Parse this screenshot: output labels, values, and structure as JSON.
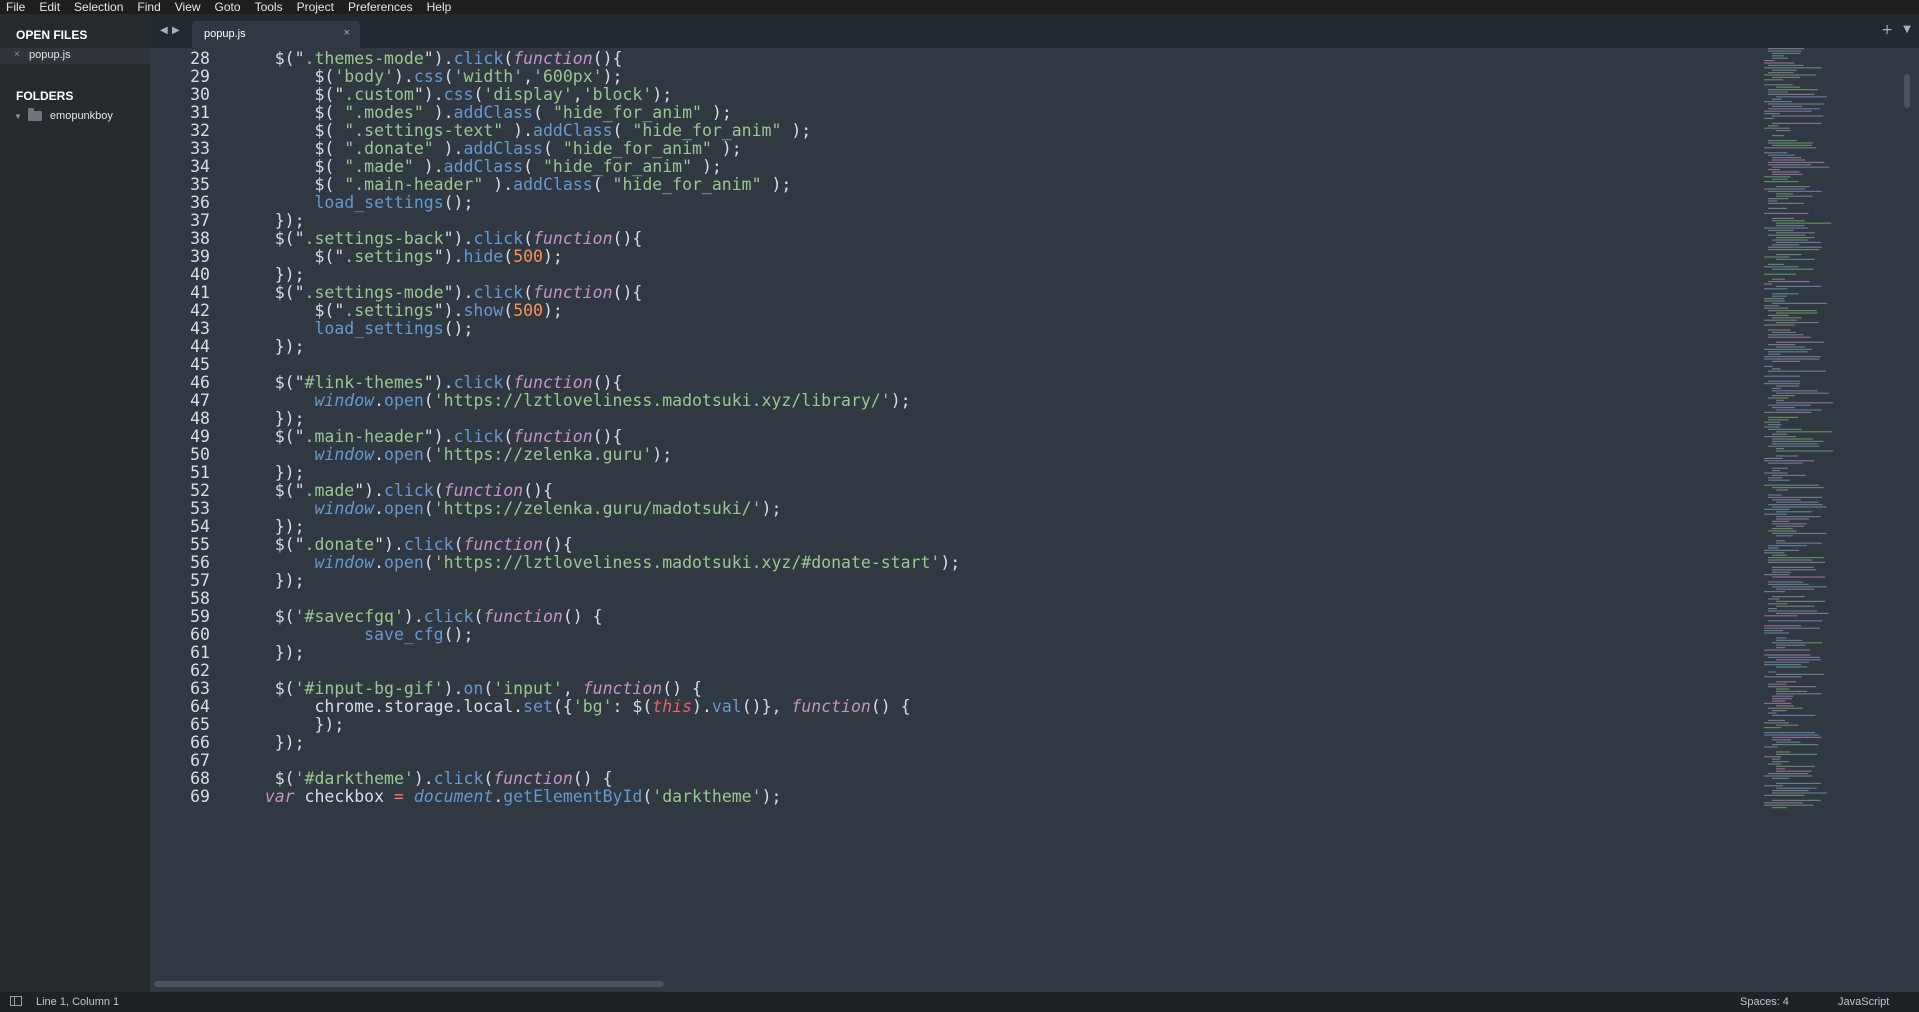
{
  "menu": [
    "File",
    "Edit",
    "Selection",
    "Find",
    "View",
    "Goto",
    "Tools",
    "Project",
    "Preferences",
    "Help"
  ],
  "sidebar": {
    "open_files_heading": "OPEN FILES",
    "open_file": "popup.js",
    "open_file_close": "×",
    "folders_heading": "FOLDERS",
    "folder": "emopunkboy"
  },
  "tabs": {
    "active_label": "popup.js",
    "close_glyph": "×",
    "nav_left": "◀",
    "nav_right": "▶",
    "plus": "+",
    "dropdown": "▼"
  },
  "icons": {
    "panel": "side-panel-icon",
    "folder": "folder-icon",
    "close": "close-icon",
    "chevron": "chevron-down-icon"
  },
  "colors": {
    "background": "#303841",
    "string": "#99c794",
    "method": "#6699cc",
    "keyword": "#c594c5",
    "number": "#f99157",
    "this": "#ec5f67"
  },
  "editor": {
    "first_line": 28,
    "lines": [
      [
        [
          "",
          "    $(\""
        ],
        [
          "s",
          ".themes-mode"
        ],
        [
          "",
          "\")."
        ],
        [
          "m",
          "click"
        ],
        [
          "",
          "("
        ],
        [
          "k",
          "function"
        ],
        [
          "",
          "(){"
        ]
      ],
      [
        [
          "",
          "        $("
        ],
        [
          "s",
          "'body'"
        ],
        [
          "",
          ")."
        ],
        [
          "m",
          "css"
        ],
        [
          "",
          "("
        ],
        [
          "s",
          "'width'"
        ],
        [
          "",
          ","
        ],
        [
          "s",
          "'600px'"
        ],
        [
          "",
          ");"
        ]
      ],
      [
        [
          "",
          "        $(\""
        ],
        [
          "s",
          ".custom"
        ],
        [
          "",
          "\")."
        ],
        [
          "m",
          "css"
        ],
        [
          "",
          "("
        ],
        [
          "s",
          "'display'"
        ],
        [
          "",
          ","
        ],
        [
          "s",
          "'block'"
        ],
        [
          "",
          ");"
        ]
      ],
      [
        [
          "",
          "        $( "
        ],
        [
          "s",
          "\".modes\""
        ],
        [
          "",
          " )."
        ],
        [
          "m",
          "addClass"
        ],
        [
          "",
          "( "
        ],
        [
          "s",
          "\"hide_for_anim\""
        ],
        [
          "",
          " );"
        ]
      ],
      [
        [
          "",
          "        $( "
        ],
        [
          "s",
          "\".settings-text\""
        ],
        [
          "",
          " )."
        ],
        [
          "m",
          "addClass"
        ],
        [
          "",
          "( "
        ],
        [
          "s",
          "\"hide_for_anim\""
        ],
        [
          "",
          " );"
        ]
      ],
      [
        [
          "",
          "        $( "
        ],
        [
          "s",
          "\".donate\""
        ],
        [
          "",
          " )."
        ],
        [
          "m",
          "addClass"
        ],
        [
          "",
          "( "
        ],
        [
          "s",
          "\"hide_for_anim\""
        ],
        [
          "",
          " );"
        ]
      ],
      [
        [
          "",
          "        $( "
        ],
        [
          "s",
          "\".made\""
        ],
        [
          "",
          " )."
        ],
        [
          "m",
          "addClass"
        ],
        [
          "",
          "( "
        ],
        [
          "s",
          "\"hide_for_anim\""
        ],
        [
          "",
          " );"
        ]
      ],
      [
        [
          "",
          "        $( "
        ],
        [
          "s",
          "\".main-header\""
        ],
        [
          "",
          " )."
        ],
        [
          "m",
          "addClass"
        ],
        [
          "",
          "( "
        ],
        [
          "s",
          "\"hide_for_anim\""
        ],
        [
          "",
          " );"
        ]
      ],
      [
        [
          "",
          "        "
        ],
        [
          "m",
          "load_settings"
        ],
        [
          "",
          "();"
        ]
      ],
      [
        [
          "",
          "    });"
        ]
      ],
      [
        [
          "",
          "    $(\""
        ],
        [
          "s",
          ".settings-back"
        ],
        [
          "",
          "\")."
        ],
        [
          "m",
          "click"
        ],
        [
          "",
          "("
        ],
        [
          "k",
          "function"
        ],
        [
          "",
          "(){"
        ]
      ],
      [
        [
          "",
          "        $(\""
        ],
        [
          "s",
          ".settings"
        ],
        [
          "",
          "\")."
        ],
        [
          "m",
          "hide"
        ],
        [
          "",
          "("
        ],
        [
          "n",
          "500"
        ],
        [
          "",
          ");"
        ]
      ],
      [
        [
          "",
          "    });"
        ]
      ],
      [
        [
          "",
          "    $(\""
        ],
        [
          "s",
          ".settings-mode"
        ],
        [
          "",
          "\")."
        ],
        [
          "m",
          "click"
        ],
        [
          "",
          "("
        ],
        [
          "k",
          "function"
        ],
        [
          "",
          "(){"
        ]
      ],
      [
        [
          "",
          "        $(\""
        ],
        [
          "s",
          ".settings"
        ],
        [
          "",
          "\")."
        ],
        [
          "m",
          "show"
        ],
        [
          "",
          "("
        ],
        [
          "n",
          "500"
        ],
        [
          "",
          ");"
        ]
      ],
      [
        [
          "",
          "        "
        ],
        [
          "m",
          "load_settings"
        ],
        [
          "",
          "();"
        ]
      ],
      [
        [
          "",
          "    });"
        ]
      ],
      [
        [
          "",
          ""
        ]
      ],
      [
        [
          "",
          "    $(\""
        ],
        [
          "s",
          "#link-themes"
        ],
        [
          "",
          "\")."
        ],
        [
          "m",
          "click"
        ],
        [
          "",
          "("
        ],
        [
          "k",
          "function"
        ],
        [
          "",
          "(){"
        ]
      ],
      [
        [
          "",
          "        "
        ],
        [
          "w",
          "window"
        ],
        [
          "",
          "."
        ],
        [
          "m",
          "open"
        ],
        [
          "",
          "("
        ],
        [
          "s",
          "'https://lztloveliness.madotsuki.xyz/library/'"
        ],
        [
          "",
          ");"
        ]
      ],
      [
        [
          "",
          "    });"
        ]
      ],
      [
        [
          "",
          "    $(\""
        ],
        [
          "s",
          ".main-header"
        ],
        [
          "",
          "\")."
        ],
        [
          "m",
          "click"
        ],
        [
          "",
          "("
        ],
        [
          "k",
          "function"
        ],
        [
          "",
          "(){"
        ]
      ],
      [
        [
          "",
          "        "
        ],
        [
          "w",
          "window"
        ],
        [
          "",
          "."
        ],
        [
          "m",
          "open"
        ],
        [
          "",
          "("
        ],
        [
          "s",
          "'https://zelenka.guru'"
        ],
        [
          "",
          ");"
        ]
      ],
      [
        [
          "",
          "    });"
        ]
      ],
      [
        [
          "",
          "    $(\""
        ],
        [
          "s",
          ".made"
        ],
        [
          "",
          "\")."
        ],
        [
          "m",
          "click"
        ],
        [
          "",
          "("
        ],
        [
          "k",
          "function"
        ],
        [
          "",
          "(){"
        ]
      ],
      [
        [
          "",
          "        "
        ],
        [
          "w",
          "window"
        ],
        [
          "",
          "."
        ],
        [
          "m",
          "open"
        ],
        [
          "",
          "("
        ],
        [
          "s",
          "'https://zelenka.guru/madotsuki/'"
        ],
        [
          "",
          ");"
        ]
      ],
      [
        [
          "",
          "    });"
        ]
      ],
      [
        [
          "",
          "    $(\""
        ],
        [
          "s",
          ".donate"
        ],
        [
          "",
          "\")."
        ],
        [
          "m",
          "click"
        ],
        [
          "",
          "("
        ],
        [
          "k",
          "function"
        ],
        [
          "",
          "(){"
        ]
      ],
      [
        [
          "",
          "        "
        ],
        [
          "w",
          "window"
        ],
        [
          "",
          "."
        ],
        [
          "m",
          "open"
        ],
        [
          "",
          "("
        ],
        [
          "s",
          "'https://lztloveliness.madotsuki.xyz/#donate-start'"
        ],
        [
          "",
          ");"
        ]
      ],
      [
        [
          "",
          "    });"
        ]
      ],
      [
        [
          "",
          ""
        ]
      ],
      [
        [
          "",
          "    $("
        ],
        [
          "s",
          "'#savecfgq'"
        ],
        [
          "",
          ")."
        ],
        [
          "m",
          "click"
        ],
        [
          "",
          "("
        ],
        [
          "k",
          "function"
        ],
        [
          "",
          "() {"
        ]
      ],
      [
        [
          "",
          "             "
        ],
        [
          "m",
          "save_cfg"
        ],
        [
          "",
          "();"
        ]
      ],
      [
        [
          "",
          "    });"
        ]
      ],
      [
        [
          "",
          ""
        ]
      ],
      [
        [
          "",
          "    $("
        ],
        [
          "s",
          "'#input-bg-gif'"
        ],
        [
          "",
          ")."
        ],
        [
          "m",
          "on"
        ],
        [
          "",
          "("
        ],
        [
          "s",
          "'input'"
        ],
        [
          "",
          ", "
        ],
        [
          "k",
          "function"
        ],
        [
          "",
          "() {"
        ]
      ],
      [
        [
          "",
          "        chrome.storage.local."
        ],
        [
          "m",
          "set"
        ],
        [
          "",
          "({"
        ],
        [
          "s",
          "'bg'"
        ],
        [
          "",
          ": $("
        ],
        [
          "r",
          "this"
        ],
        [
          "",
          ")."
        ],
        [
          "m",
          "val"
        ],
        [
          "",
          "()}, "
        ],
        [
          "k",
          "function"
        ],
        [
          "",
          "() {"
        ]
      ],
      [
        [
          "",
          "        });"
        ]
      ],
      [
        [
          "",
          "    });"
        ]
      ],
      [
        [
          "",
          ""
        ]
      ],
      [
        [
          "",
          "    $("
        ],
        [
          "s",
          "'#darktheme'"
        ],
        [
          "",
          ")."
        ],
        [
          "m",
          "click"
        ],
        [
          "",
          "("
        ],
        [
          "k",
          "function"
        ],
        [
          "",
          "() {"
        ]
      ],
      [
        [
          "",
          "   "
        ],
        [
          "k",
          "var"
        ],
        [
          "",
          " checkbox "
        ],
        [
          "o",
          "="
        ],
        [
          "",
          " "
        ],
        [
          "w",
          "document"
        ],
        [
          "",
          "."
        ],
        [
          "m",
          "getElementById"
        ],
        [
          "",
          "("
        ],
        [
          "s",
          "'darktheme'"
        ],
        [
          "",
          ");"
        ]
      ]
    ]
  },
  "status": {
    "position": "Line 1, Column 1",
    "spaces": "Spaces: 4",
    "syntax": "JavaScript"
  }
}
